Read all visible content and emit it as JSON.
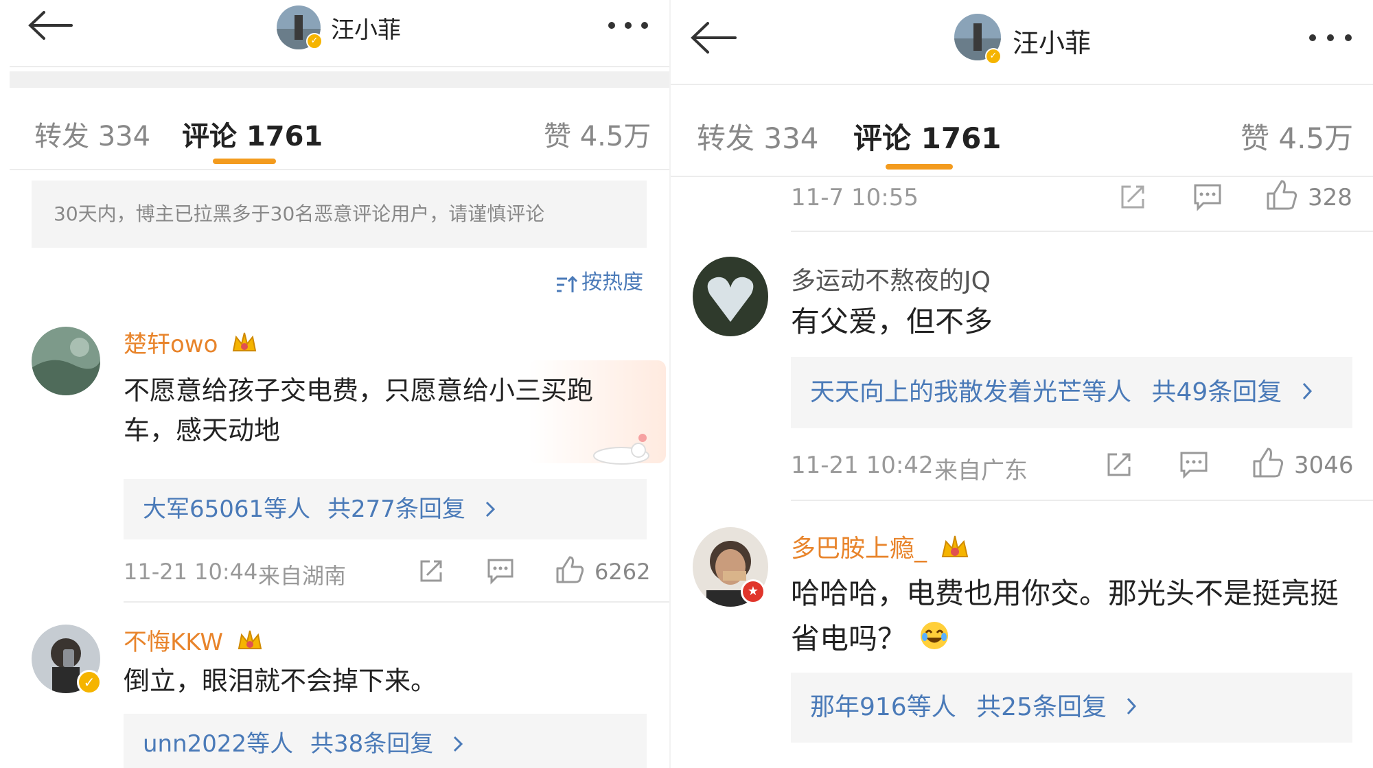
{
  "left": {
    "header": {
      "title": "汪小菲"
    },
    "tabs": {
      "repost": "转发 334",
      "comments": "评论 1761",
      "likes": "赞 4.5万"
    },
    "notice": "30天内，博主已拉黑多于30名恶意评论用户，请谨慎评论",
    "sort_label": "按热度",
    "comments": [
      {
        "username": "楚轩owo",
        "text": "不愿意给孩子交电费，只愿意给小三买跑车，感天动地",
        "reply_users": "大军65061等人",
        "reply_count": "共277条回复",
        "time": "11-21 10:44",
        "location": "来自湖南",
        "likes": "6262"
      },
      {
        "username": "不悔KKW",
        "text": "倒立，眼泪就不会掉下来。",
        "reply_users": "unn2022等人",
        "reply_count": "共38条回复"
      }
    ]
  },
  "right": {
    "header": {
      "title": "汪小菲"
    },
    "tabs": {
      "repost": "转发 334",
      "comments": "评论 1761",
      "likes": "赞 4.5万"
    },
    "prev_meta": {
      "time": "11-7 10:55",
      "likes": "328"
    },
    "comments": [
      {
        "username": "多运动不熬夜的JQ",
        "text": "有父爱，但不多",
        "reply_users": "天天向上的我散发着光芒等人",
        "reply_count": "共49条回复",
        "time": "11-21 10:42",
        "location": "来自广东",
        "likes": "3046"
      },
      {
        "username": "多巴胺上瘾_",
        "text": "哈哈哈，电费也用你交。那光头不是挺亮挺省电吗？",
        "reply_users": "那年916等人",
        "reply_count": "共25条回复"
      }
    ]
  },
  "icons": [
    "back-arrow-icon",
    "more-icon",
    "verified-badge-icon",
    "sort-icon",
    "crown-icon",
    "repost-icon",
    "comment-icon",
    "like-icon",
    "chevron-right-icon",
    "laugh-emoji-icon"
  ],
  "colors": {
    "accent": "#f39b1e",
    "link": "#4a7ab8",
    "username_vip": "#e8842b"
  }
}
